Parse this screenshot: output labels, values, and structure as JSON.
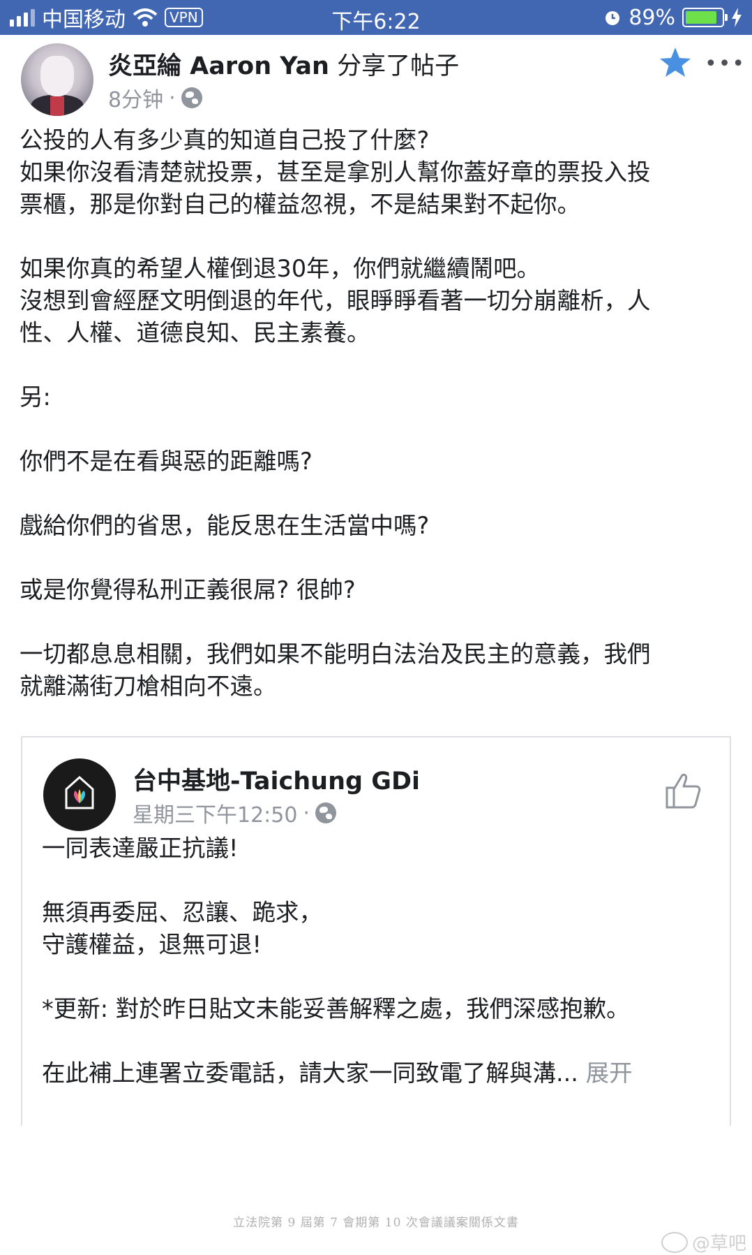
{
  "status_bar": {
    "carrier": "中国移动",
    "vpn": "VPN",
    "time": "下午6:22",
    "battery_percent": "89%",
    "battery_level": 0.89,
    "bg_color": "#4267b2"
  },
  "post": {
    "author": "炎亞綸 Aaron Yan",
    "action": " 分享了帖子",
    "time": "8分钟",
    "separator": "·",
    "privacy_icon": "globe-icon",
    "paragraphs": [
      "公投的人有多少真的知道自己投了什麼?\n如果你沒看清楚就投票，甚至是拿別人幫你蓋好章的票投入投\n票櫃，那是你對自己的權益忽視，不是結果對不起你。",
      "如果你真的希望人權倒退30年，你們就繼續鬧吧。\n沒想到會經歷文明倒退的年代，眼睜睜看著一切分崩離析，人\n性、人權、道德良知、民主素養。",
      "另:",
      "你們不是在看與惡的距離嗎?",
      "戲給你們的省思，能反思在生活當中嗎?",
      "或是你覺得私刑正義很屌? 很帥?",
      "一切都息息相關，我們如果不能明白法治及民主的意義，我們\n就離滿街刀槍相向不遠。"
    ]
  },
  "shared": {
    "page_name": "台中基地-Taichung GDi",
    "time": "星期三下午12:50",
    "separator": "·",
    "paragraphs": [
      "一同表達嚴正抗議!",
      "無須再委屈、忍讓、跪求，\n守護權益，退無可退!",
      "*更新: 對於昨日貼文未能妥善解釋之處，我們深感抱歉。"
    ],
    "last_line": "在此補上連署立委電話，請大家一同致電了解與溝...",
    "expand_label": " 展开"
  },
  "footer": {
    "document_caption": "立法院第 9 屆第 7 會期第 10 次會議議案關係文書",
    "watermark": "@草吧"
  },
  "icons": [
    "star-icon",
    "more-icon",
    "globe-icon",
    "thumbs-up-icon",
    "signal-icon",
    "wifi-icon",
    "alarm-icon",
    "battery-icon",
    "charging-icon"
  ]
}
